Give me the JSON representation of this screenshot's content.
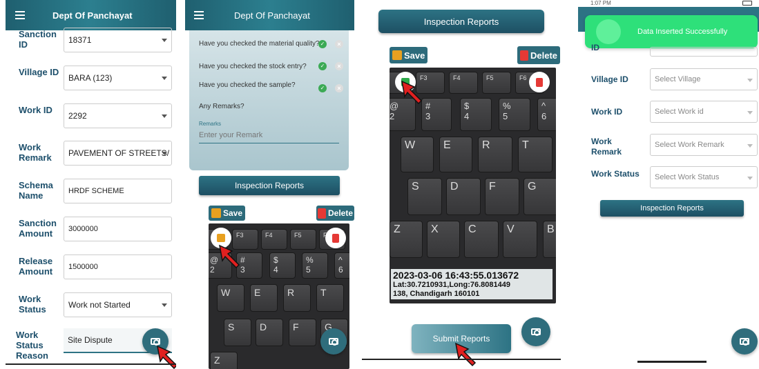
{
  "p1": {
    "title": "Dept Of Panchayat",
    "fields": [
      {
        "label": "Sanction ID",
        "value": "18371",
        "dropdown": true
      },
      {
        "label": "Village ID",
        "value": "BARA (123)",
        "dropdown": true
      },
      {
        "label": "Work ID",
        "value": "2292",
        "dropdown": true
      },
      {
        "label": "Work Remark",
        "value": "PAVEMENT OF STREETS/",
        "dropdown": true
      },
      {
        "label": "Schema Name",
        "value": "HRDF SCHEME",
        "dropdown": false
      },
      {
        "label": "Sanction Amount",
        "value": "3000000",
        "dropdown": false
      },
      {
        "label": "Release Amount",
        "value": "1500000",
        "dropdown": false
      },
      {
        "label": "Work Status",
        "value": "Work not Started",
        "dropdown": true
      },
      {
        "label": "Work Status Reason",
        "value": "Site Dispute",
        "dropdown": false
      }
    ]
  },
  "p2": {
    "title": "Dept Of Panchayat",
    "questions": [
      "Have you checked the material quality?",
      "Have you checked the stock entry?",
      "Have you checked the sample?"
    ],
    "remarks_heading": "Any Remarks?",
    "remarks_label": "Remarks",
    "remarks_placeholder": "Enter your Remark",
    "inspection_button": "Inspection Reports",
    "save": "Save",
    "delete": "Delete"
  },
  "p3": {
    "inspection_button": "Inspection Reports",
    "save": "Save",
    "delete": "Delete",
    "timestamp": "2023-03-06 16:43:55.013672",
    "latlong": "Lat:30.7210931,Long:76.8081449",
    "address": "138, Chandigarh 160101",
    "submit": "Submit Reports"
  },
  "p4": {
    "status_time": "1:07 PM",
    "toast": "Data Inserted Successfully",
    "fields": [
      {
        "label": "ID",
        "value": ""
      },
      {
        "label": "Village ID",
        "value": "Select Village"
      },
      {
        "label": "Work ID",
        "value": "Select Work id"
      },
      {
        "label": "Work Remark",
        "value": "Select Work Remark"
      },
      {
        "label": "Work Status",
        "value": "Select Work Status"
      }
    ],
    "inspection_button": "Inspection Reports"
  },
  "keys": {
    "row_f": [
      "F3",
      "F4",
      "F5",
      "F6"
    ],
    "row_num": [
      "@ 2",
      "# 3",
      "$ 4",
      "% 5",
      "^ 6"
    ],
    "row_q": [
      "W",
      "E",
      "R",
      "T"
    ],
    "row_a": [
      "S",
      "D",
      "F",
      "G"
    ],
    "row_z": [
      "Z",
      "X",
      "C",
      "V",
      "B"
    ]
  },
  "colors": {
    "teal": "#2d7384",
    "toast": "#2ee07a",
    "label": "#1d4f6b"
  }
}
